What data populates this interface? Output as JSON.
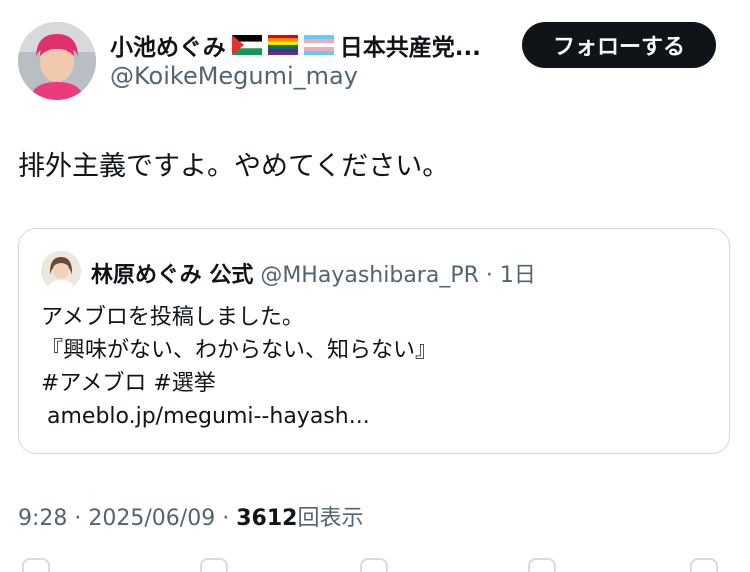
{
  "author": {
    "display_name": "小池めぐみ",
    "name_suffix": "日本共産党...",
    "handle": "@KoikeMegumi_may",
    "follow_label": "フォローする"
  },
  "tweet": {
    "text": "排外主義ですよ。やめてください。"
  },
  "quote": {
    "name": "林原めぐみ 公式",
    "handle": "@MHayashibara_PR",
    "separator": "·",
    "time": "1日",
    "lines": [
      "アメブロを投稿しました。",
      "『興味がない、わからない、知らない』",
      "#アメブロ  #選挙",
      "ameblo.jp/megumi--hayash..."
    ]
  },
  "footer": {
    "time": "9:28",
    "date": "2025/06/09",
    "separator": "·",
    "views_count": "3612",
    "views_label": "回表示"
  },
  "icons": [
    "palestine-flag-icon",
    "rainbow-flag-icon",
    "transgender-flag-icon"
  ],
  "colors": {
    "button_bg": "#0f1419",
    "secondary_text": "#536471",
    "card_border": "#cfd9de"
  }
}
